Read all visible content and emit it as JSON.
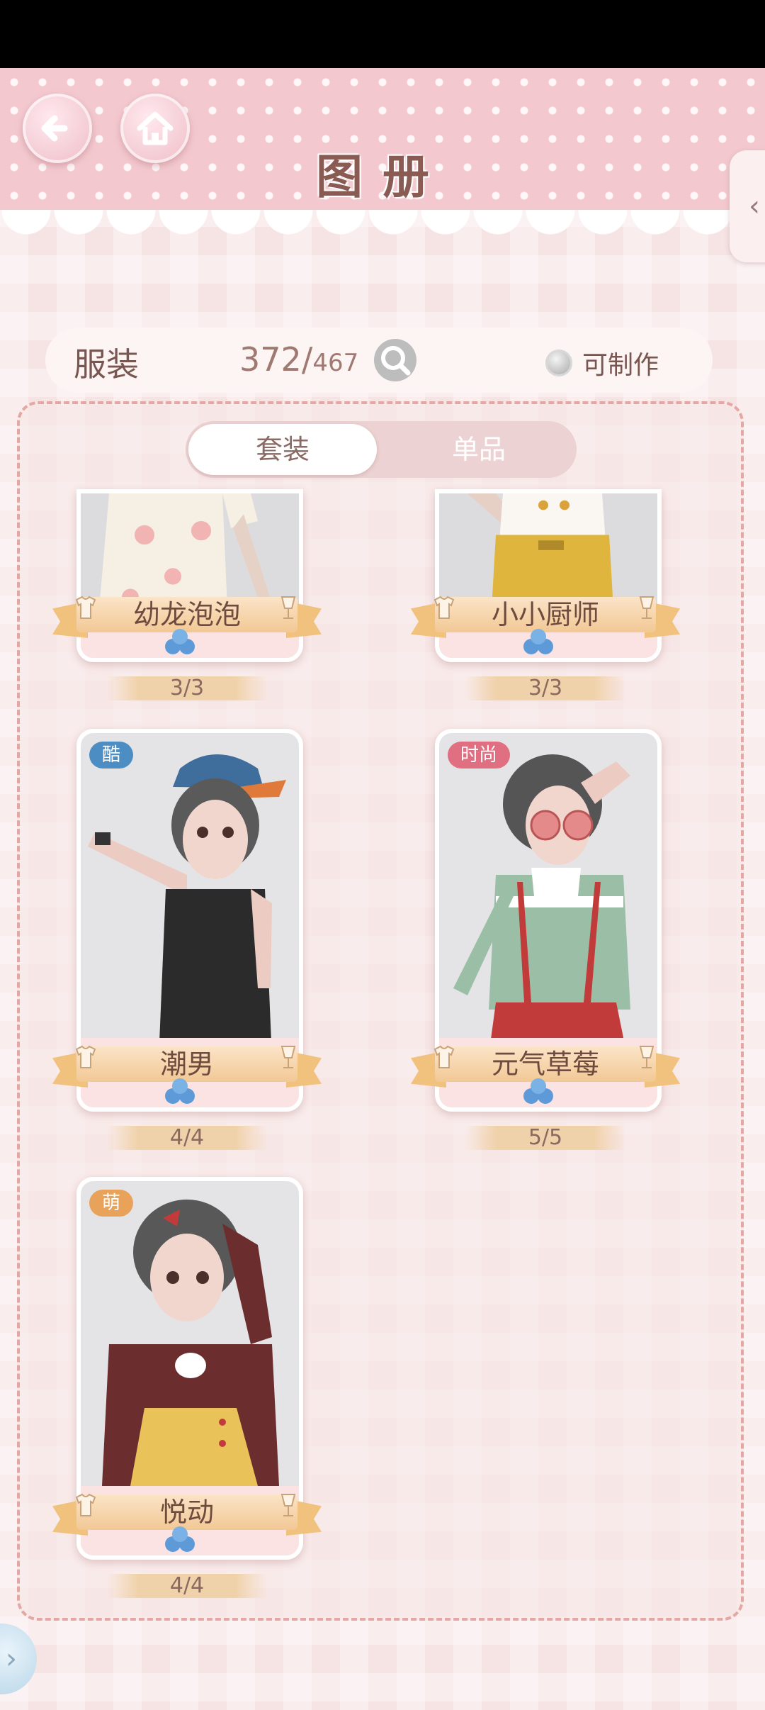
{
  "header": {
    "title": "图册"
  },
  "stats": {
    "category": "服装",
    "owned": "372",
    "separator": "/",
    "total": "467",
    "craftable_label": "可制作"
  },
  "tabs": [
    {
      "label": "套装"
    },
    {
      "label": "单品"
    }
  ],
  "cards": [
    {
      "name": "幼龙泡泡",
      "progress": "3/3",
      "tag": ""
    },
    {
      "name": "小小厨师",
      "progress": "3/3",
      "tag": ""
    },
    {
      "name": "潮男",
      "progress": "4/4",
      "tag": "酷"
    },
    {
      "name": "元气草莓",
      "progress": "5/5",
      "tag": "时尚"
    },
    {
      "name": "悦动",
      "progress": "4/4",
      "tag": "萌"
    }
  ],
  "colors": {
    "header_pink": "#f3c9cf",
    "accent_brown": "#8a5b52",
    "ribbon_gold": "#f2c894",
    "tag_cool": "#4c8ec4",
    "tag_fashion": "#e06f82",
    "tag_cute": "#e8a25a"
  },
  "icons": {
    "back": "back-arrow-icon",
    "home": "home-icon",
    "search": "magnifier-icon",
    "gem": "blue-gem-icon"
  }
}
